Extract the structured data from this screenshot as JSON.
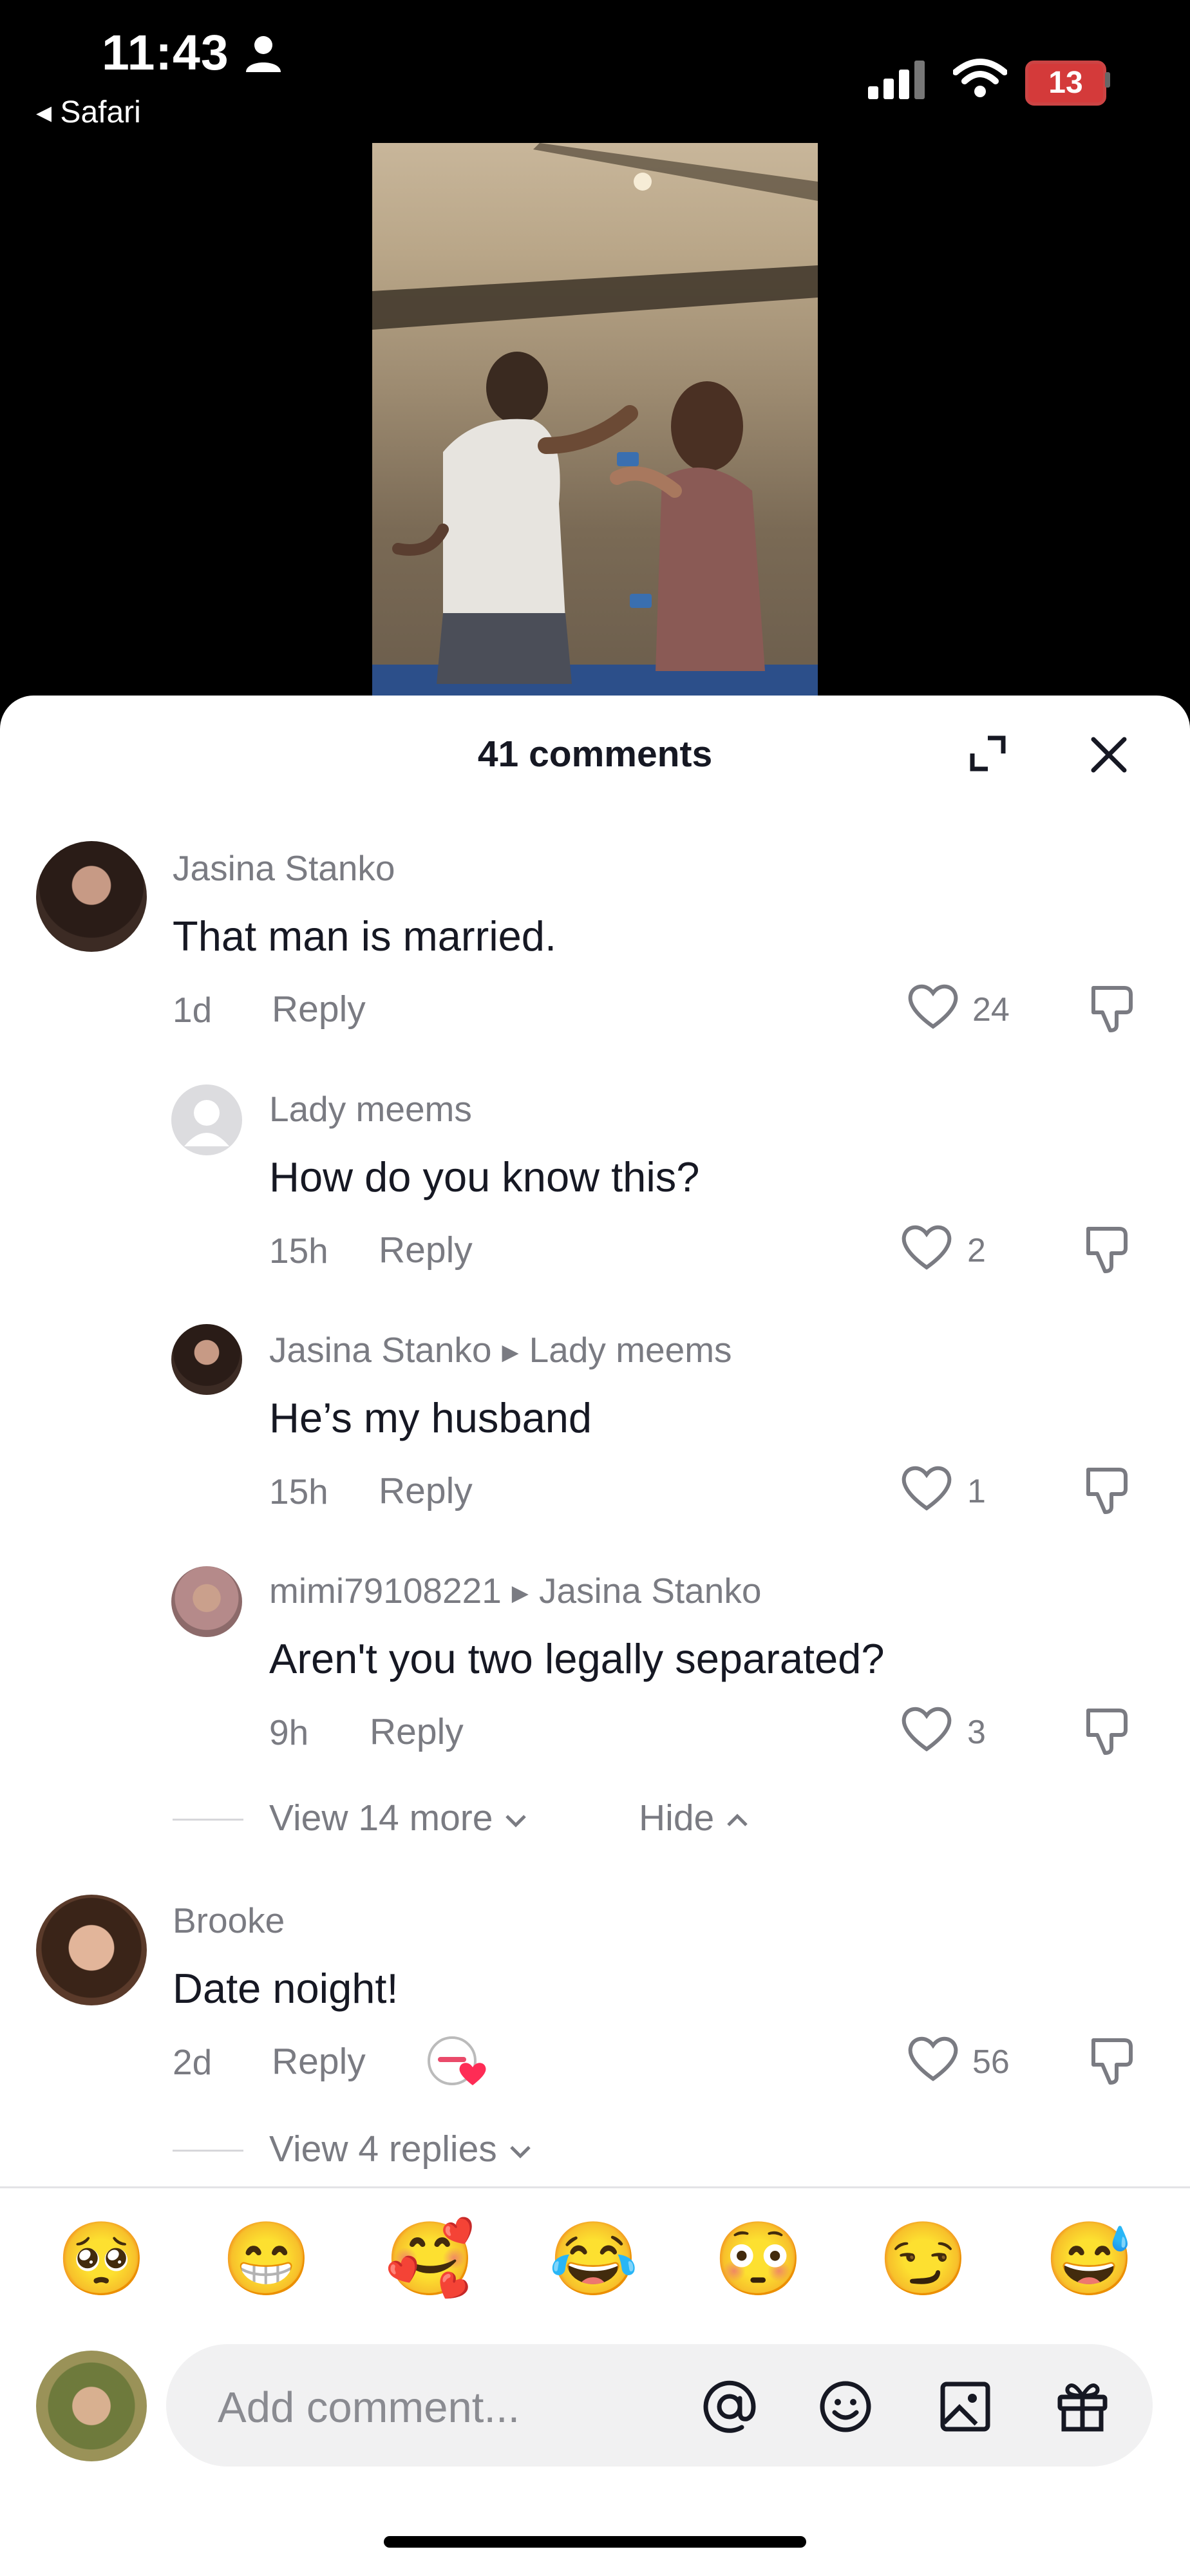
{
  "status_bar": {
    "time": "11:43",
    "back_app": "◂ Safari",
    "battery": "13"
  },
  "sheet": {
    "title": "41 comments"
  },
  "comments": [
    {
      "username": "Jasina Stanko",
      "text": "That man is married.",
      "age": "1d",
      "reply": "Reply",
      "likes": "24"
    },
    {
      "username": "Lady meems",
      "text": "How do you know this?",
      "age": "15h",
      "reply": "Reply",
      "likes": "2"
    },
    {
      "username": "Jasina Stanko",
      "reply_to": "Lady meems",
      "text": "He’s my husband",
      "age": "15h",
      "reply": "Reply",
      "likes": "1"
    },
    {
      "username": "mimi79108221",
      "reply_to": "Jasina Stanko",
      "text": "Aren't you two legally separated?",
      "age": "9h",
      "reply": "Reply",
      "likes": "3"
    },
    {
      "username": "Brooke",
      "text": "Date noight!",
      "age": "2d",
      "reply": "Reply",
      "likes": "56"
    }
  ],
  "thread_controls": {
    "view_more": "View 14 more",
    "hide": "Hide",
    "view_replies": "View 4 replies"
  },
  "emoji_bar": [
    "🥺",
    "😁",
    "🥰",
    "😂",
    "😳",
    "😏",
    "😅"
  ],
  "composer": {
    "placeholder": "Add comment..."
  },
  "colors": {
    "like_icon": "#7a7b82",
    "battery": "#d43a3a",
    "text": "#161823",
    "muted": "#7a7b82"
  }
}
